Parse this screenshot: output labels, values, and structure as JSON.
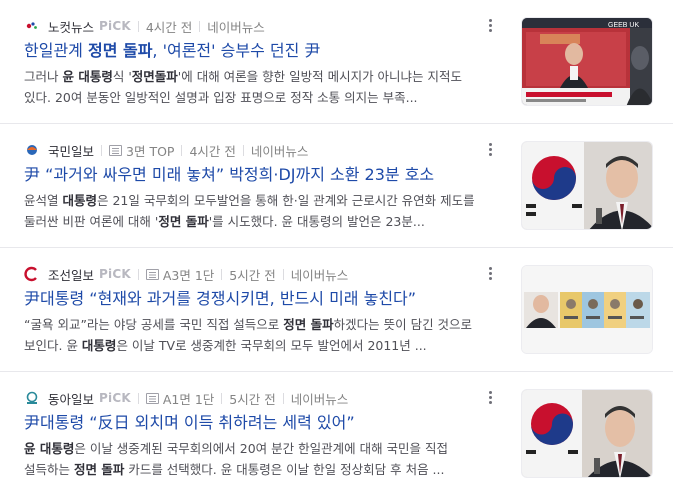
{
  "articles": [
    {
      "press": "노컷뉴스",
      "logo_text": "CBS",
      "pick": "PiCK",
      "paper_page": "",
      "time": "4시간 전",
      "source": "네이버뉴스",
      "title_pre": "한일관계 ",
      "title_bold": "정면 돌파",
      "title_post": ", '여론전' 승부수 던진 尹",
      "desc_a": "그러나 ",
      "desc_b": "윤 대통령",
      "desc_c": "식 '",
      "desc_d": "정면돌파",
      "desc_e": "'에 대해 여론을 향한 일방적 메시지가 아니냐는 지적도 있다. 20여 분동안 일방적인 설명과 입장 표명으로 정작 소통 의지는 부족...",
      "thumb": "tv-broadcast"
    },
    {
      "press": "국민일보",
      "logo_text": "국",
      "pick": "",
      "paper_page": "3면 TOP",
      "time": "4시간 전",
      "source": "네이버뉴스",
      "title_pre": "尹 “과거와 싸우면 미래 놓쳐” 박정희·DJ까지 소환 23분 호소",
      "title_bold": "",
      "title_post": "",
      "desc_a": "윤석열 ",
      "desc_b": "대통령",
      "desc_c": "은 21일 국무회의 모두발언을 통해 한·일 관계와 근로시간 유연화 제도를 둘러싼 비판 여론에 대해 '",
      "desc_d": "정면 돌파",
      "desc_e": "'를 시도했다. 윤 대통령의 발언은 23분...",
      "thumb": "president-flag"
    },
    {
      "press": "조선일보",
      "logo_text": "C",
      "pick": "PiCK",
      "paper_page": "A3면 1단",
      "time": "5시간 전",
      "source": "네이버뉴스",
      "title_pre": "尹",
      "title_bold": "대통령",
      "title_post": " “현재와 과거를 경쟁시키면, 반드시 미래 놓친다”",
      "desc_a": "“굴욕 외교”라는 야당 공세를 국민 직접 설득으로 ",
      "desc_b": "정면 돌파",
      "desc_c": "하겠다는 뜻이 담긴 것으로 보인다. 윤 ",
      "desc_d": "대통령",
      "desc_e": "은 이날 TV로 생중계한 국무회의 모두 발언에서 2011년 ...",
      "thumb": "president-portraits"
    },
    {
      "press": "동아일보",
      "logo_text": "동",
      "pick": "PiCK",
      "paper_page": "A1면 1단",
      "time": "5시간 전",
      "source": "네이버뉴스",
      "title_pre": "尹",
      "title_bold": "대통령",
      "title_post": " “反日 외치며 이득 취하려는 세력 있어”",
      "desc_a": "",
      "desc_b": "윤 대통령",
      "desc_c": "은 이날 생중계된 국무회의에서 20여 분간 한일관계에 대해 국민을 직접 설득하는 ",
      "desc_d": "정면 돌파",
      "desc_e": " 카드를 선택했다. 윤 대통령은 이날 한일 정상회담 후 처음 ...",
      "thumb": "president-flag"
    }
  ],
  "thumb_caption": "GEEB UK",
  "colors": {
    "title": "#1e4aa8",
    "meta": "#848484",
    "pick": "#b8b8c0"
  }
}
